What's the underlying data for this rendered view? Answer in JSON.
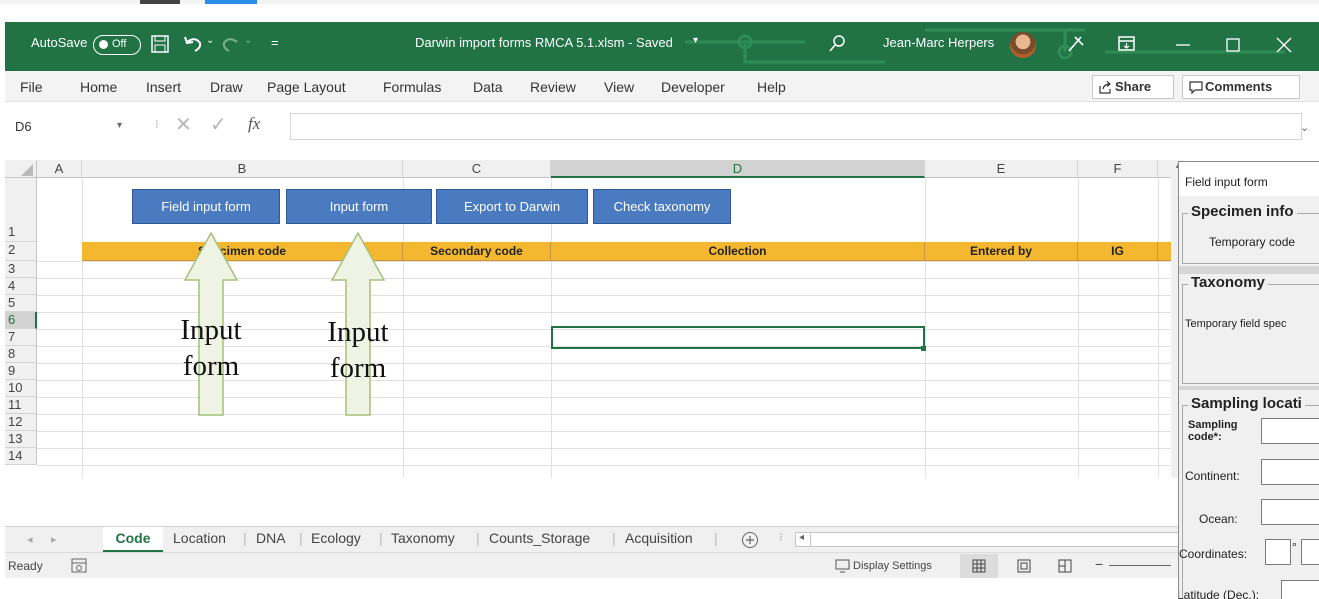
{
  "window": {
    "autosave_label": "AutoSave",
    "autosave_state": "Off",
    "title": "Darwin import forms RMCA 5.1.xlsm  -  Saved",
    "user_name": "Jean-Marc Herpers",
    "accent_color": "#217346"
  },
  "ribbon": {
    "tabs": [
      "File",
      "Home",
      "Insert",
      "Draw",
      "Page Layout",
      "Formulas",
      "Data",
      "Review",
      "View",
      "Developer",
      "Help"
    ],
    "share_label": "Share",
    "comments_label": "Comments"
  },
  "formula_bar": {
    "name_box": "D6",
    "fx_label": "fx",
    "value": ""
  },
  "grid": {
    "columns": [
      "A",
      "B",
      "C",
      "D",
      "E",
      "F"
    ],
    "rows": [
      "1",
      "2",
      "3",
      "4",
      "5",
      "6",
      "7",
      "8",
      "9",
      "10",
      "11",
      "12",
      "13",
      "14"
    ],
    "macro_buttons": [
      "Field input form",
      "Input form",
      "Export to Darwin",
      "Check taxonomy"
    ],
    "row2_headers": [
      "Specimen code",
      "Secondary code",
      "Collection",
      "Entered by",
      "IG"
    ],
    "selected_cell": "D6",
    "annotations": [
      {
        "line1": "Input",
        "line2": "form"
      },
      {
        "line1": "Input",
        "line2": "form"
      }
    ]
  },
  "sheet_tabs": [
    "Code",
    "Location",
    "DNA",
    "Ecology",
    "Taxonomy",
    "Counts_Storage",
    "Acquisition"
  ],
  "active_sheet": "Code",
  "status_bar": {
    "status": "Ready",
    "display_settings": "Display Settings"
  },
  "userform": {
    "title": "Field input form",
    "specimen_section": "Specimen info",
    "temporary_code_label": "Temporary code",
    "taxonomy_section": "Taxonomy",
    "temporary_field_label": "Temporary field spec",
    "sampling_section": "Sampling locati",
    "sampling_code_label": "Sampling code*:",
    "continent_label": "Continent:",
    "ocean_label": "Ocean:",
    "coordinates_label": "Coordinates:",
    "degree_symbol": "°",
    "latitude_label": "Latitude (Dec.):"
  }
}
